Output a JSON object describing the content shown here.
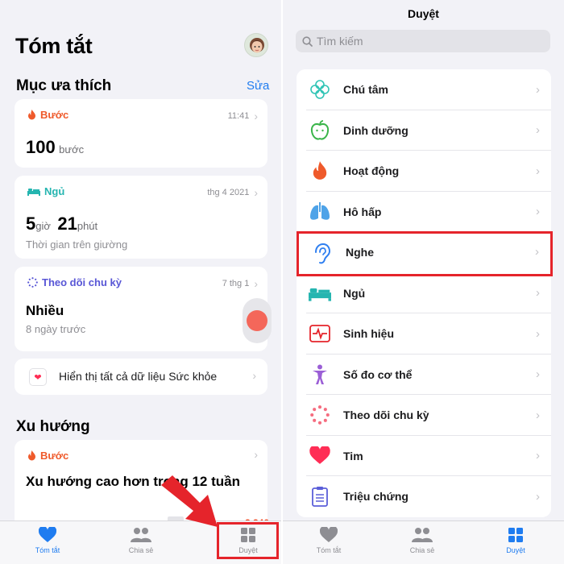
{
  "left": {
    "title": "Tóm tắt",
    "favorites_title": "Mục ưa thích",
    "edit_label": "Sửa",
    "steps_card": {
      "category": "Bước",
      "time": "11:41",
      "value": "100",
      "unit": "bước"
    },
    "sleep_card": {
      "category": "Ngủ",
      "time": "thg 4 2021",
      "hours": "5",
      "hours_unit": "giờ",
      "minutes": "21",
      "minutes_unit": "phút",
      "caption": "Thời gian trên giường"
    },
    "cycle_card": {
      "category": "Theo dõi chu kỳ",
      "time": "7 thg 1",
      "value": "Nhiều",
      "caption": "8 ngày trước"
    },
    "show_all_label": "Hiển thị tất cả dữ liệu Sức khỏe",
    "trends_title": "Xu hướng",
    "trend_card": {
      "category": "Bước",
      "text": "Xu hướng cao hơn trong 12 tuần",
      "value": "2.340"
    },
    "tabs": [
      {
        "label": "Tóm tắt"
      },
      {
        "label": "Chia sẻ"
      },
      {
        "label": "Duyệt"
      }
    ]
  },
  "right": {
    "title": "Duyệt",
    "search_placeholder": "Tìm kiếm",
    "categories": [
      {
        "label": "Chú tâm"
      },
      {
        "label": "Dinh dưỡng"
      },
      {
        "label": "Hoạt động"
      },
      {
        "label": "Hô hấp"
      },
      {
        "label": "Nghe"
      },
      {
        "label": "Ngủ"
      },
      {
        "label": "Sinh hiệu"
      },
      {
        "label": "Số đo cơ thể"
      },
      {
        "label": "Theo dõi chu kỳ"
      },
      {
        "label": "Tim"
      },
      {
        "label": "Triệu chứng"
      }
    ],
    "tabs": [
      {
        "label": "Tóm tắt"
      },
      {
        "label": "Chia sẻ"
      },
      {
        "label": "Duyệt"
      }
    ]
  },
  "colors": {
    "accent": "#1f7cf0",
    "steps": "#ef5a2b",
    "sleep": "#25b5b0",
    "cycle": "#5856d6",
    "highlight": "#e5242b"
  }
}
